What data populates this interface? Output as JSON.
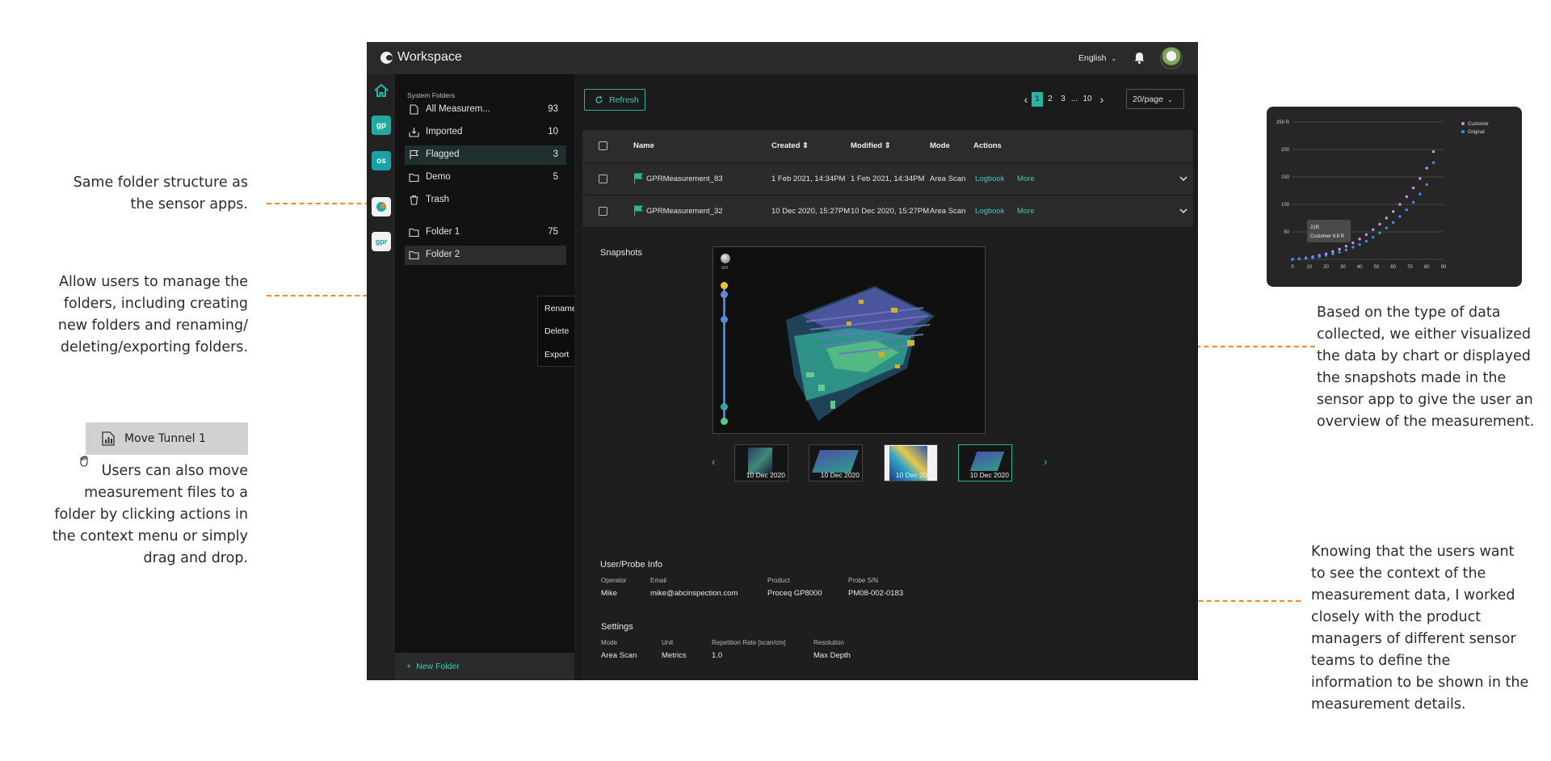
{
  "annotations": {
    "folder_structure": [
      "Same folder structure as",
      "the sensor apps."
    ],
    "manage_folders": [
      "Allow users to manage the",
      "folders, including creating",
      "new folders and renaming/",
      "deleting/exporting folders."
    ],
    "move_files": [
      "Users can also move",
      "measurement files to a",
      "folder by clicking actions in",
      "the context menu or simply",
      "drag and drop."
    ],
    "visualize": [
      "Based on the type of data",
      "collected, we either visualized",
      "the data by chart or displayed",
      "the snapshots made in the",
      "sensor app to give the user an",
      "overview of the measurement."
    ],
    "context": [
      "Knowing that the users want",
      "to see the context of the",
      "measurement data, I worked",
      "closely with the product",
      "managers of different sensor",
      "teams to define the",
      "information to be shown in the",
      "measurement details."
    ]
  },
  "drag_chip": {
    "label": "Move Tunnel 1",
    "icon": "chart-file-icon"
  },
  "app": {
    "title": "Workspace",
    "language": "English",
    "rail": [
      {
        "label": "",
        "icon": "home-icon"
      },
      {
        "label": "gp",
        "color": "#1fa9a0"
      },
      {
        "label": "os",
        "color": "#1aa3a6"
      },
      {
        "label": "",
        "icon": "eagle-app-icon",
        "color": "#f2f2f2"
      },
      {
        "label": "gpr",
        "color": "#f2f2f2"
      }
    ],
    "sidebar": {
      "section_title": "System Folders",
      "system_folders": [
        {
          "label": "All Measurem...",
          "count": "93",
          "icon": "file-icon"
        },
        {
          "label": "Imported",
          "count": "10",
          "icon": "import-icon"
        },
        {
          "label": "Flagged",
          "count": "3",
          "icon": "flag-icon"
        },
        {
          "label": "Demo",
          "count": "5",
          "icon": "folder-icon"
        },
        {
          "label": "Trash",
          "count": "",
          "icon": "trash-icon"
        }
      ],
      "user_folders": [
        {
          "label": "Folder 1",
          "count": "75",
          "icon": "folder-icon"
        },
        {
          "label": "Folder 2",
          "count": "",
          "icon": "folder-icon"
        }
      ],
      "context_menu": [
        "Rename",
        "Delete",
        "Export"
      ],
      "new_folder": "New Folder"
    },
    "toolbar": {
      "refresh": "Refresh",
      "pages": [
        "1",
        "2",
        "3",
        "...",
        "10"
      ],
      "current_page": "1",
      "per_page": "20/page"
    },
    "table": {
      "columns": [
        "Name",
        "Created",
        "Modified",
        "Mode",
        "Actions"
      ],
      "rows": [
        {
          "name": "GPRMeasurement_83",
          "created": "1 Feb 2021, 14:34PM",
          "modified": "1 Feb 2021, 14:34PM",
          "mode": "Area Scan",
          "action1": "Logbook",
          "action2": "More"
        },
        {
          "name": "GPRMeasurement_32",
          "created": "10 Dec 2020, 15:27PM",
          "modified": "10 Dec 2020, 15:27PM",
          "mode": "Area Scan",
          "action1": "Logbook",
          "action2": "More"
        }
      ]
    },
    "details": {
      "snapshots_title": "Snapshots",
      "depth_unit": "cm",
      "thumb_dates": [
        "10 Dec 2020",
        "10 Dec 2020",
        "10 Dec 2020",
        "10 Dec 2020"
      ],
      "user_probe_title": "User/Probe Info",
      "user_probe": [
        {
          "label": "Operator",
          "value": "Mike"
        },
        {
          "label": "Email",
          "value": "mike@abcinspection.com"
        },
        {
          "label": "Product",
          "value": "Proceq GP8000"
        },
        {
          "label": "Probe S/N",
          "value": "PM08-002-0183"
        }
      ],
      "settings_title": "Settings",
      "settings": [
        {
          "label": "Mode",
          "value": "Area Scan"
        },
        {
          "label": "Unit",
          "value": "Metrics"
        },
        {
          "label": "Repetition Rate [scan/cm]",
          "value": "1.0"
        },
        {
          "label": "Resolution",
          "value": "Max Depth"
        }
      ]
    }
  },
  "chart_data": {
    "type": "scatter",
    "title": "",
    "xlabel": "",
    "ylabel": "",
    "xlim": [
      0,
      90
    ],
    "ylim": [
      0,
      250
    ],
    "x_ticks": [
      "0",
      "10",
      "20",
      "30",
      "40",
      "50",
      "60",
      "70",
      "80",
      "90"
    ],
    "y_ticks": [
      "",
      "50",
      "100",
      "150",
      "200",
      "250 R"
    ],
    "grid": true,
    "legend_position": "top-right",
    "tooltip": [
      "21R",
      "Customer 9.8 R"
    ],
    "series": [
      {
        "name": "Customer",
        "color": "#d98cf0",
        "x": [
          0,
          4,
          8,
          12,
          16,
          20,
          24,
          28,
          32,
          36,
          40,
          44,
          48,
          52,
          56,
          60,
          64,
          68,
          72,
          76,
          80,
          84
        ],
        "y": [
          0,
          1,
          2.5,
          4.5,
          7,
          10,
          14,
          18.5,
          24,
          30,
          37,
          45,
          54,
          64,
          75,
          87,
          100,
          114,
          130,
          147,
          166,
          196
        ]
      },
      {
        "name": "Original",
        "color": "#3b8ef0",
        "x": [
          0,
          4,
          8,
          12,
          16,
          20,
          24,
          28,
          32,
          36,
          40,
          44,
          48,
          52,
          56,
          60,
          64,
          68,
          72,
          76,
          80,
          84
        ],
        "y": [
          0,
          0.5,
          1.5,
          3,
          5,
          7,
          10,
          13,
          17,
          22,
          27,
          33,
          40,
          48,
          57,
          67,
          78,
          90,
          104,
          119,
          136,
          176
        ]
      }
    ]
  }
}
